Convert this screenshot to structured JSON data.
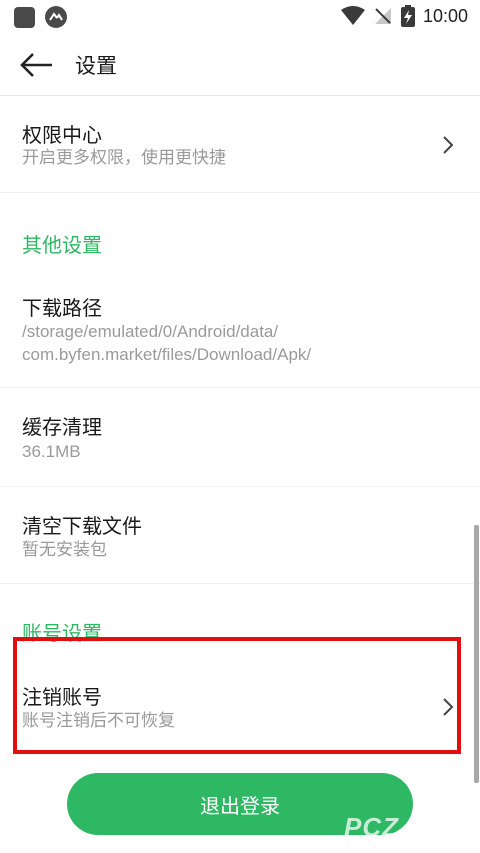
{
  "status_bar": {
    "time": "10:00",
    "icons": [
      "app-square-icon",
      "app-circle-icon",
      "wifi-icon",
      "no-sim-icon",
      "battery-charging-icon"
    ]
  },
  "toolbar": {
    "back_icon": "arrow-left-icon",
    "title": "设置"
  },
  "rows": {
    "permissions": {
      "title": "权限中心",
      "subtitle": "开启更多权限，使用更快捷"
    },
    "other_settings_header": "其他设置",
    "download_path": {
      "title": "下载路径",
      "line1": "/storage/emulated/0/Android/data/",
      "line2": "com.byfen.market/files/Download/Apk/"
    },
    "cache": {
      "title": "缓存清理",
      "subtitle": "36.1MB"
    },
    "clear_downloads": {
      "title": "清空下载文件",
      "subtitle": "暂无安装包"
    },
    "account_settings_header": "账号设置",
    "delete_account": {
      "title": "注销账号",
      "subtitle": "账号注销后不可恢复"
    }
  },
  "logout_label": "退出登录",
  "watermark": "PCZ",
  "colors": {
    "accent_green": "#2eb865",
    "button_green": "#2fb863",
    "highlight_red": "#e01010",
    "subtitle_gray": "#9a9a9a"
  }
}
